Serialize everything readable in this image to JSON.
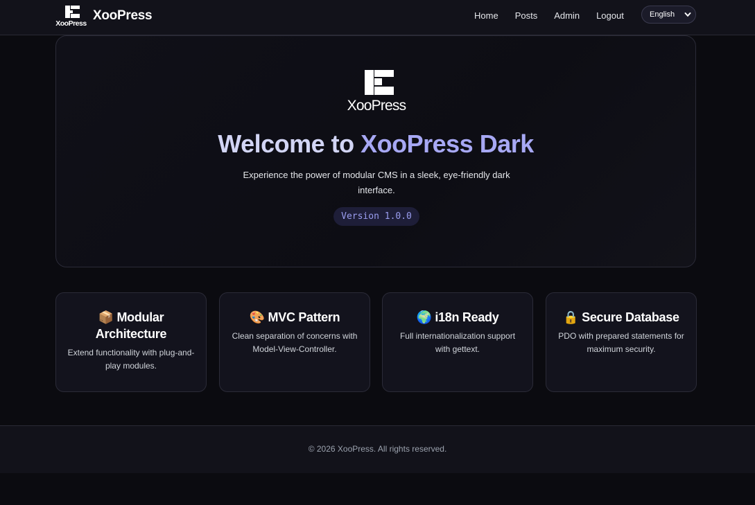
{
  "header": {
    "brand_name": "XooPress",
    "nav": [
      "Home",
      "Posts",
      "Admin",
      "Logout"
    ],
    "language": "English"
  },
  "hero": {
    "title_part1": "Welcome to ",
    "title_part2": "XooPress Dark",
    "subtitle": "Experience the power of modular CMS in a sleek, eye-friendly dark interface.",
    "version": "Version 1.0.0"
  },
  "features": [
    {
      "emoji": "📦",
      "title": "Modular Architecture",
      "desc": "Extend functionality with plug-and-play modules."
    },
    {
      "emoji": "🎨",
      "title": "MVC Pattern",
      "desc": "Clean separation of concerns with Model-View-Controller."
    },
    {
      "emoji": "🌍",
      "title": "i18n Ready",
      "desc": "Full internationalization support with gettext."
    },
    {
      "emoji": "🔒",
      "title": "Secure Database",
      "desc": "PDO with prepared statements for maximum security."
    }
  ],
  "footer": {
    "copyright": "© 2026 XooPress. All rights reserved."
  },
  "colors": {
    "background": "#0b0b10",
    "accent": "#a7a8f4",
    "title_light": "#d2d5f5",
    "badge_bg": "#1e1e38"
  }
}
